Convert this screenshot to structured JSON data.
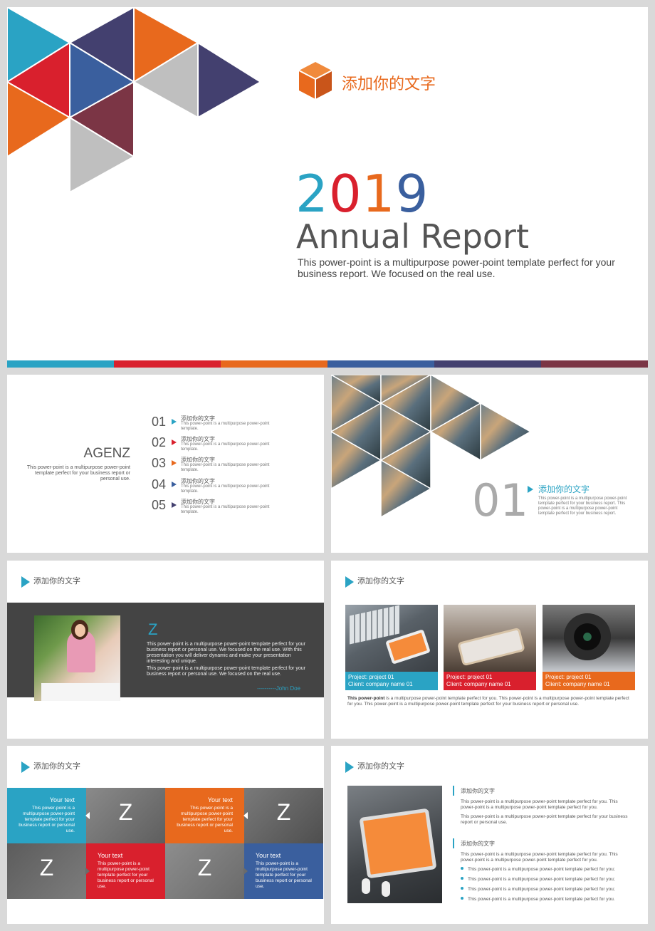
{
  "colors": {
    "teal": "#2aa3c4",
    "red": "#d9202d",
    "orange": "#e8691d",
    "blue": "#3a5f9e",
    "navy": "#43406f",
    "maroon": "#7b3545",
    "gray": "#bfbfbf",
    "dark": "#444444"
  },
  "cover": {
    "badge_text": "添加你的文字",
    "year_digits": [
      "2",
      "0",
      "1",
      "9"
    ],
    "title": "Annual Report",
    "subtitle": "This power-point is a multipurpose power-point template perfect for your business report. We focused on the real use."
  },
  "agenda": {
    "title": "AGENZ",
    "description": "This power-point is a multipurpose power-point template perfect for your business report or personal use.",
    "items": [
      {
        "num": "01",
        "head": "添加你的文字",
        "text": "This power-point is a multipurpose power-point template."
      },
      {
        "num": "02",
        "head": "添加你的文字",
        "text": "This power-point is a multipurpose power-point template."
      },
      {
        "num": "03",
        "head": "添加你的文字",
        "text": "This power-point is a multipurpose power-point template."
      },
      {
        "num": "04",
        "head": "添加你的文字",
        "text": "This power-point is a multipurpose power-point template."
      },
      {
        "num": "05",
        "head": "添加你的文字",
        "text": "This power-point is a multipurpose power-point template."
      }
    ]
  },
  "section": {
    "number": "01",
    "head": "添加你的文字",
    "text": "This power-point is a multipurpose power-point template perfect for your business report. This power-point is a multipurpose power-point template perfect for your business report."
  },
  "profile": {
    "header": "添加你的文字",
    "letter": "Z",
    "para1": "This power-point is a multipurpose power-point template perfect for your business report or personal use. We focused on the real use. With this presentation you will deliver dynamic and make your presentation interesting and unique.",
    "para2": "This power-point is a multipurpose power-point template perfect for your business report or personal use. We focused on the real use.",
    "signature": "----------John Doe"
  },
  "projects": {
    "header": "添加你的文字",
    "items": [
      {
        "line1": "Project: project 01",
        "line2": "Client: company name 01"
      },
      {
        "line1": "Project: project 01",
        "line2": "Client: company name 01"
      },
      {
        "line1": "Project: project 01",
        "line2": "Client: company name 01"
      }
    ],
    "desc_bold": "This power-point",
    "desc_rest": " is a multipurpose power-point template perfect for you. This power-point is a multipurpose power-point template perfect for you.  This power-point is a multipurpose power-point template perfect for your business report or personal use."
  },
  "grid": {
    "header": "添加你的文字",
    "letter": "Z",
    "tiles": [
      {
        "title": "Your text",
        "text": "This power-point is a multipurpose power-point template perfect for your business report or personal use."
      },
      {
        "title": "Your text",
        "text": "This power-point is a multipurpose power-point template perfect for your business report or personal use."
      },
      {
        "title": "Your text",
        "text": "This power-point is a multipurpose power-point template perfect for your business report or personal use."
      },
      {
        "title": "Your text",
        "text": "This power-point is a multipurpose power-point template perfect for your business report or personal use."
      }
    ]
  },
  "earphones": {
    "header": "添加你的文字",
    "block1_head": "添加你的文字",
    "block1_p1": "This power-point is a multipurpose power-point template perfect for you. This power-point is a multipurpose power-point template perfect for you.",
    "block1_p2": "This power-point is a multipurpose power-point template perfect for your business report or personal use.",
    "block2_head": "添加你的文字",
    "block2_p1": "This power-point is a multipurpose power-point template perfect for you. This power-point is a multipurpose power-point template perfect for you.",
    "bullets": [
      "This power-point is a multipurpose power-point template perfect for you;",
      "This power-point is a multipurpose power-point template perfect for you;",
      "This power-point is a multipurpose power-point template perfect for you;",
      "This power-point is a multipurpose power-point template perfect for you."
    ]
  }
}
